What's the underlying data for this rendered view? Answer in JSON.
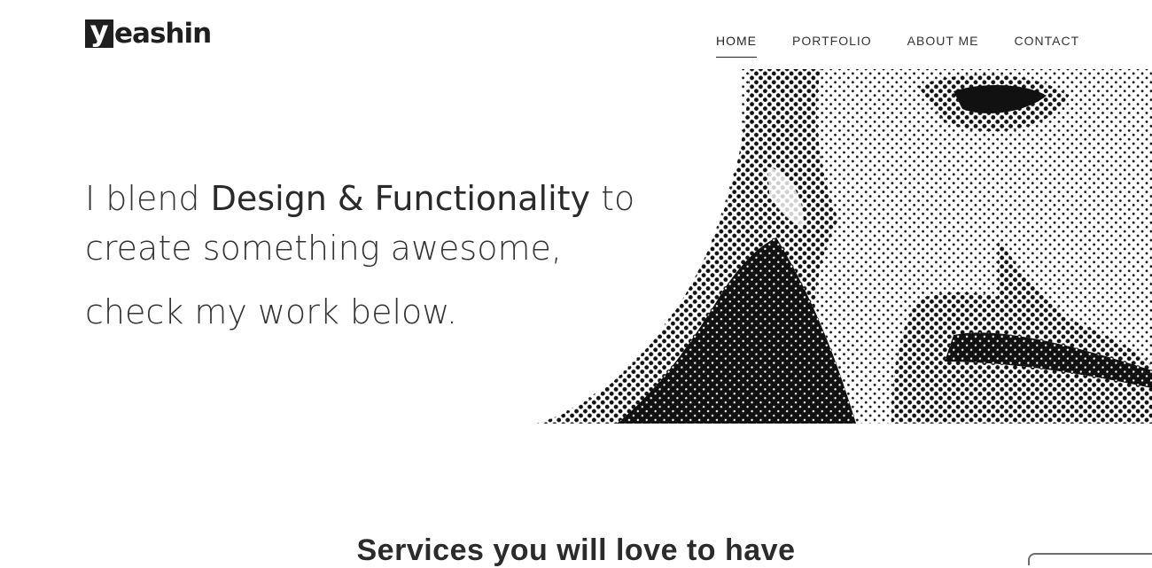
{
  "logo": {
    "mark": "y",
    "word": "eashin"
  },
  "nav": {
    "items": [
      {
        "label": "HOME",
        "active": true
      },
      {
        "label": "PORTFOLIO",
        "active": false
      },
      {
        "label": "ABOUT ME",
        "active": false
      },
      {
        "label": "CONTACT",
        "active": false
      }
    ]
  },
  "hero": {
    "line1_pre": "I blend ",
    "line1_strong": "Design & Functionality",
    "line1_post": " to",
    "line2": "create something awesome,",
    "line3": "check my work below."
  },
  "services": {
    "title": "Services you will love to have"
  }
}
